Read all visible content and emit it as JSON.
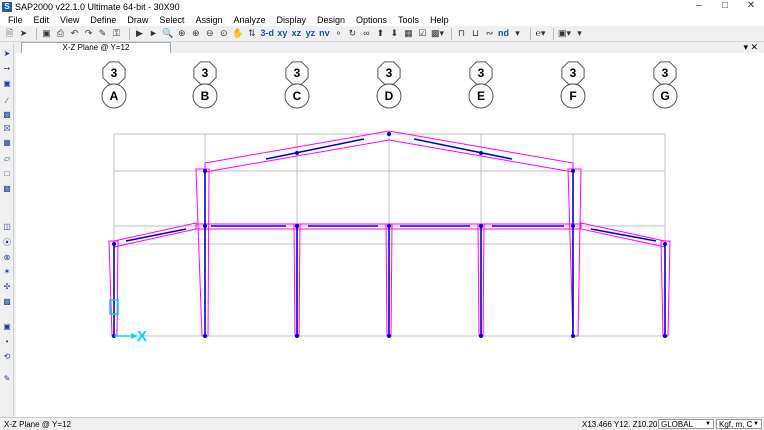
{
  "window": {
    "title": "SAP2000 v22.1.0 Ultimate 64-bit - 30X90",
    "icon": "sap2000-logo-icon"
  },
  "menu": [
    "File",
    "Edit",
    "View",
    "Define",
    "Draw",
    "Select",
    "Assign",
    "Analyze",
    "Display",
    "Design",
    "Options",
    "Tools",
    "Help"
  ],
  "toolbar": {
    "view_3d": "3-d",
    "view_xy": "xy",
    "view_xz": "xz",
    "view_yz": "yz",
    "view_nv": "nv",
    "view_nd": "nd"
  },
  "tab": {
    "label": "X-Z Plane @ Y=12"
  },
  "grid": {
    "bubbles_top": [
      "3",
      "3",
      "3",
      "3",
      "3",
      "3",
      "3"
    ],
    "bubbles_bottom": [
      "A",
      "B",
      "C",
      "D",
      "E",
      "F",
      "G"
    ]
  },
  "axis": {
    "x_label": "X"
  },
  "colors": {
    "frame": "#ff00ff",
    "member": "#0000cc",
    "grid": "#c0c0c0",
    "axis": "#00d8e8"
  },
  "status": {
    "view_name": "X-Z Plane @ Y=12",
    "coords": "X13.466  Y12.  Z10.207",
    "coord_system": "GLOBAL",
    "units": "Kgf, m, C"
  }
}
